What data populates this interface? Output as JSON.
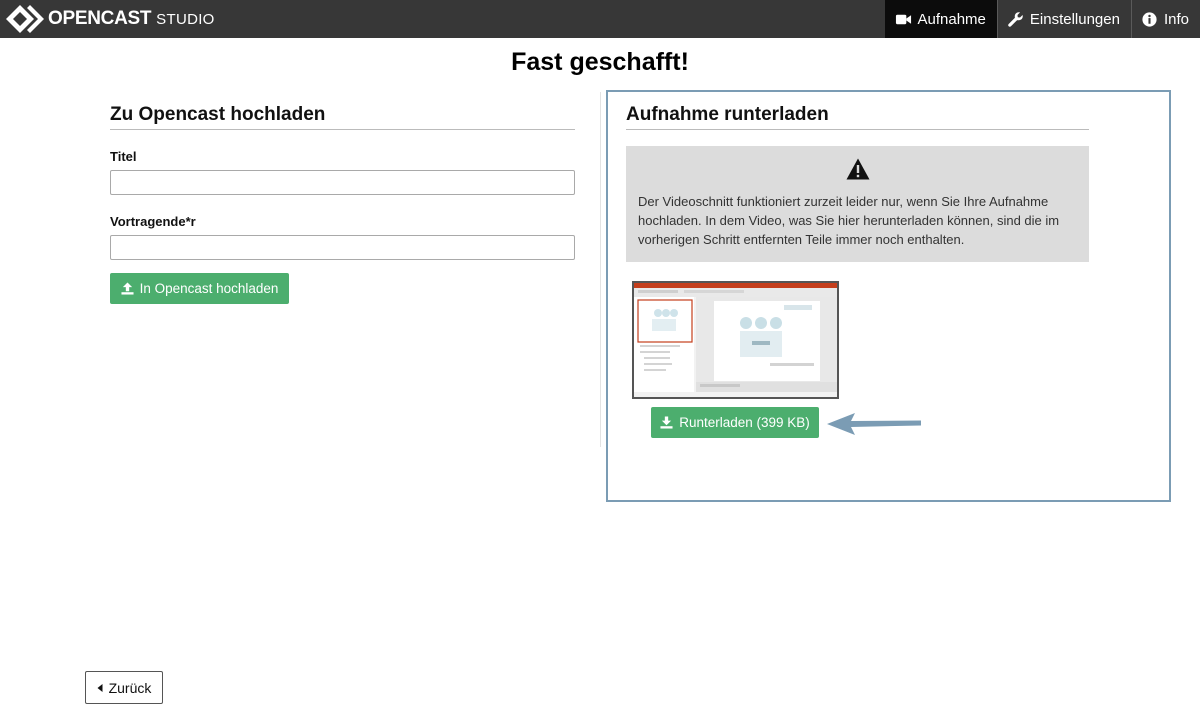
{
  "header": {
    "brand_name": "OPENCAST",
    "brand_sub": "STUDIO",
    "nav": [
      {
        "label": "Aufnahme",
        "icon": "video-camera-icon",
        "active": true
      },
      {
        "label": "Einstellungen",
        "icon": "wrench-icon",
        "active": false
      },
      {
        "label": "Info",
        "icon": "info-circle-icon",
        "active": false
      }
    ]
  },
  "page": {
    "title": "Fast geschafft!"
  },
  "upload": {
    "heading": "Zu Opencast hochladen",
    "title_label": "Titel",
    "title_value": "",
    "presenter_label": "Vortragende*r",
    "presenter_value": "",
    "button_label": "In Opencast hochladen",
    "button_icon": "upload-icon"
  },
  "download": {
    "heading": "Aufnahme runterladen",
    "notice_icon": "warning-triangle-icon",
    "notice_text": "Der Videoschnitt funktioniert zurzeit leider nur, wenn Sie Ihre Aufnahme hochladen. In dem Video, was Sie hier herunterladen können, sind die im vorherigen Schritt entfernten Teile immer noch enthalten.",
    "button_label": "Runterladen (399 KB)",
    "button_icon": "download-icon"
  },
  "footer": {
    "back_label": "Zurück"
  },
  "colors": {
    "topbar": "#373737",
    "nav_active": "#0c0c0c",
    "green": "#4cae6e",
    "frame": "#7b9cb4",
    "notice_bg": "#dcdcdc"
  }
}
